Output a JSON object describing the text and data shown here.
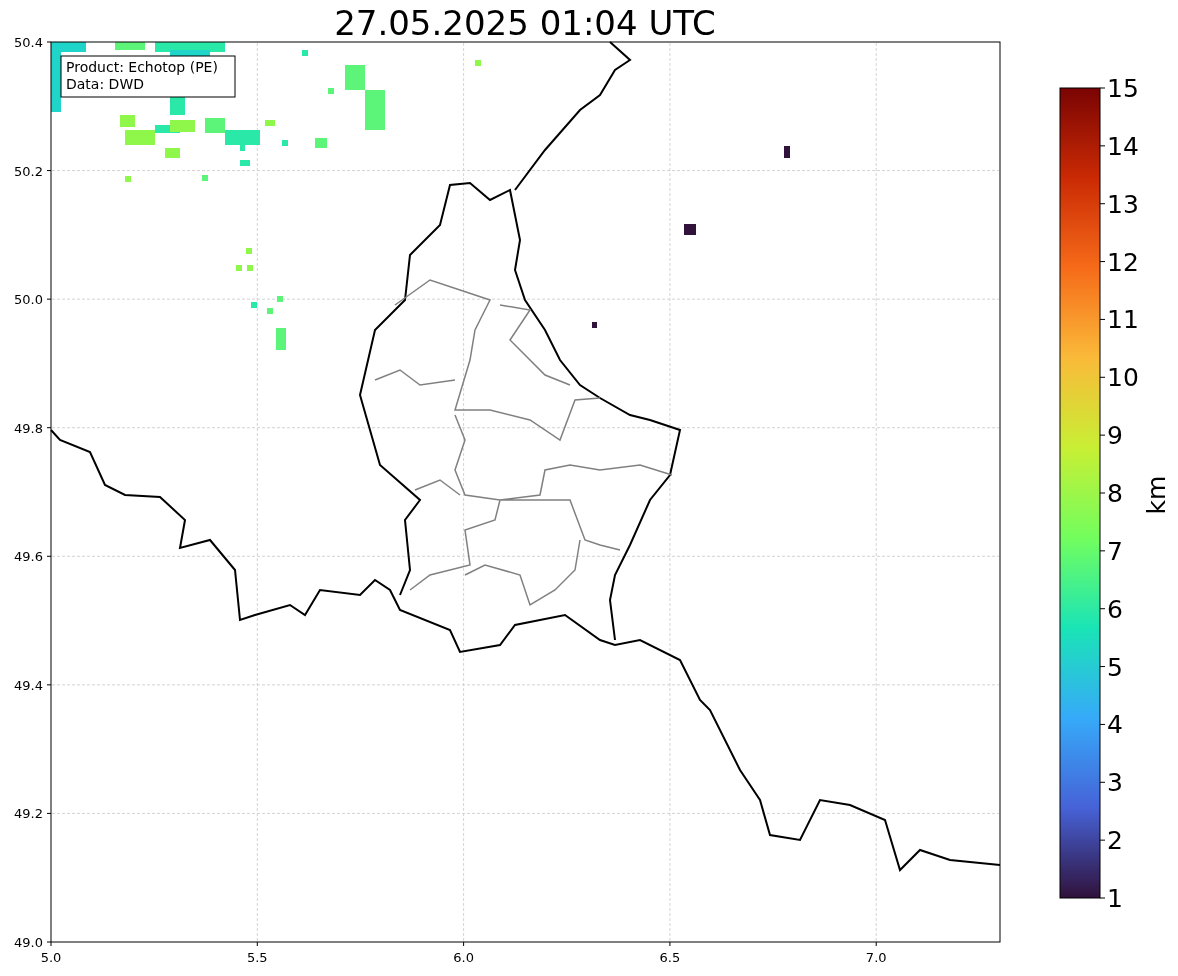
{
  "title": "27.05.2025 01:04 UTC",
  "info_box": [
    "Product: Echotop (PE)",
    "Data: DWD"
  ],
  "x_ticks": [
    "5.0",
    "5.5",
    "6.0",
    "6.5",
    "7.0"
  ],
  "y_ticks": [
    "50.4",
    "50.2",
    "50.0",
    "49.8",
    "49.6",
    "49.4",
    "49.2",
    "49.0"
  ],
  "colorbar": {
    "label": "km",
    "ticks": [
      "15",
      "14",
      "13",
      "12",
      "11",
      "10",
      "9",
      "8",
      "7",
      "6",
      "5",
      "4",
      "3",
      "2",
      "1"
    ]
  }
}
